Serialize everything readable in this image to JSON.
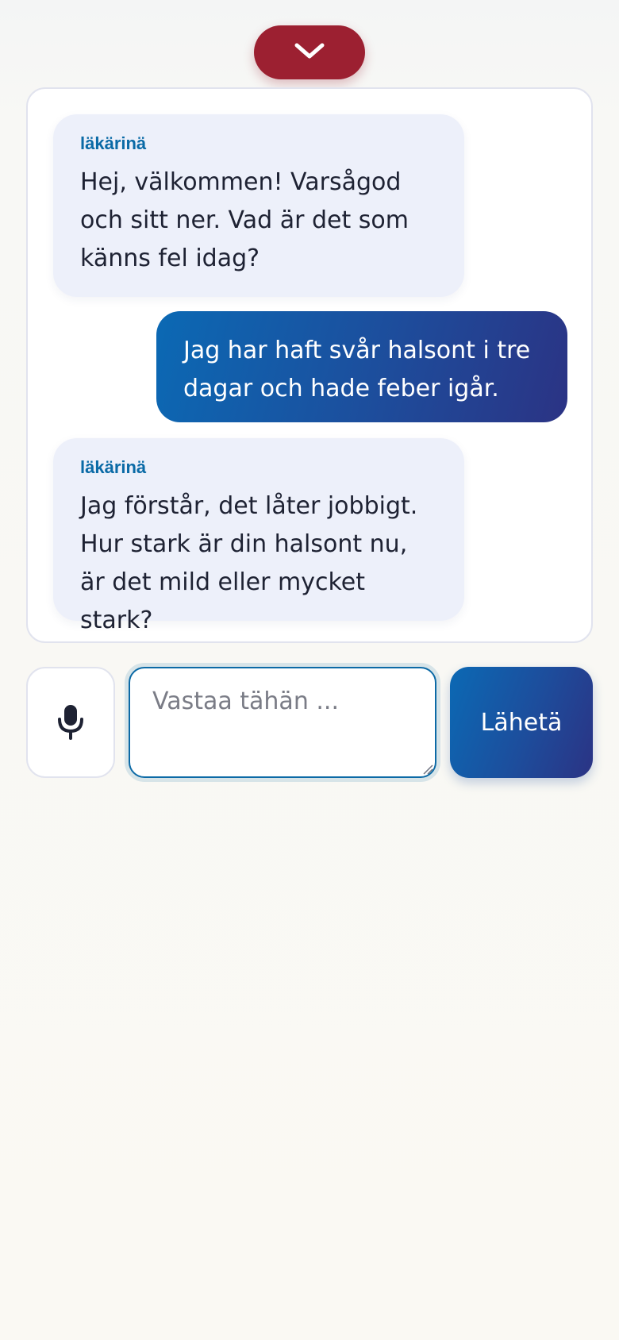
{
  "header": {
    "collapse_icon": "chevron-down-icon",
    "accent_color": "#9c2031"
  },
  "chat": {
    "messages": [
      {
        "role": "doctor",
        "speaker": "läkärinä",
        "text": "Hej, välkommen! Varsågod och sitt ner. Vad är det som känns fel idag?"
      },
      {
        "role": "user",
        "text": "Jag har haft svår halsont i tre dagar och hade feber igår."
      },
      {
        "role": "doctor",
        "speaker": "läkärinä",
        "text": "Jag förstår, det låter jobbigt. Hur stark är din halsont nu, är det mild eller mycket stark?"
      }
    ]
  },
  "composer": {
    "mic_icon": "microphone-icon",
    "input_value": "",
    "input_placeholder": "Vastaa tähän ...",
    "send_label": "Lähetä"
  },
  "colors": {
    "doctor_bubble": "#edf0fa",
    "speaker_label": "#0a6aa6",
    "user_bubble_start": "#0b69b4",
    "user_bubble_end": "#2b3384"
  }
}
